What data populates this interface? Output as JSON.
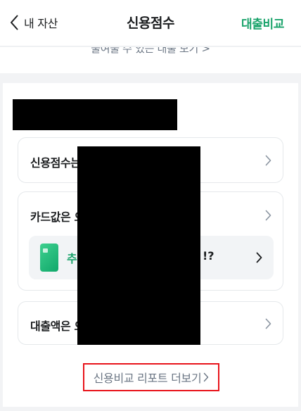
{
  "header": {
    "back_label": "내 자산",
    "title": "신용점수",
    "action_label": "대출비교"
  },
  "partial_link": "줄여줄 수 있는 대출 보기 >",
  "cards": [
    {
      "label": "신용점수는"
    },
    {
      "label": "카드값은 으"
    },
    {
      "label": "대출액은 으"
    }
  ],
  "promo": {
    "text": "추",
    "tail": "!?"
  },
  "report_link": {
    "label": "신용비교 리포트 더보기"
  },
  "colors": {
    "accent": "#1aa36b",
    "highlight_border": "#e8141b",
    "muted_text": "#6b7684"
  }
}
